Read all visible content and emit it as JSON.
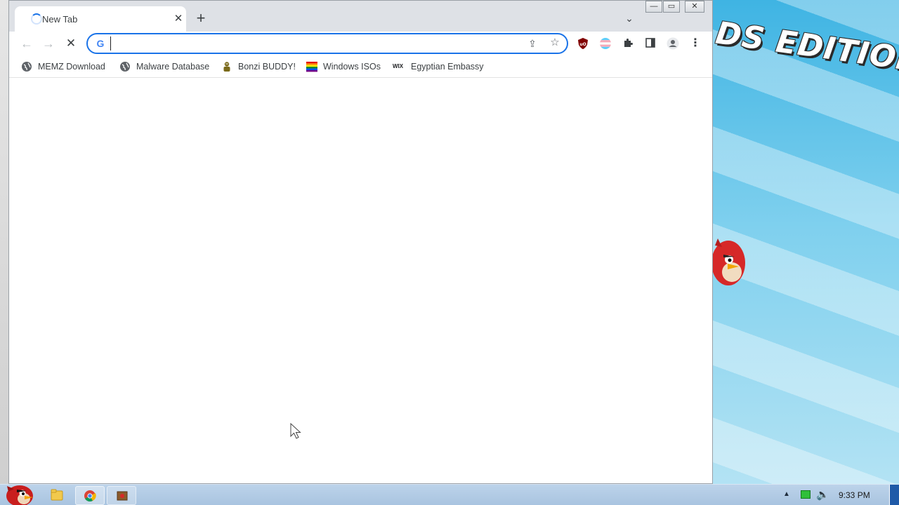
{
  "wallpaper": {
    "title_text": "DS EDITION"
  },
  "browser": {
    "tab": {
      "title": "New Tab",
      "close_glyph": "✕"
    },
    "new_tab_glyph": "+",
    "tab_search_glyph": "⌄",
    "window_controls": {
      "minimize": "—",
      "maximize": "▭",
      "close": "✕"
    },
    "toolbar": {
      "back_glyph": "←",
      "forward_glyph": "→",
      "stop_glyph": "✕",
      "omnibox_value": "",
      "omnibox_icon": "G",
      "share_glyph": "⇪",
      "star_glyph": "☆",
      "menu_glyph": "⋮",
      "puzzle_glyph": "✚"
    },
    "bookmarks": [
      {
        "label": "MEMZ Download",
        "icon": "globe-icon"
      },
      {
        "label": "Malware Database",
        "icon": "globe-icon"
      },
      {
        "label": "Bonzi BUDDY!",
        "icon": "bonzi-icon"
      },
      {
        "label": "Windows ISOs",
        "icon": "rainbow-flag-icon"
      },
      {
        "label": "Egyptian Embassy",
        "icon": "wix-icon"
      }
    ],
    "wix_text": "WIX"
  },
  "taskbar": {
    "clock": "9:33 PM",
    "tray_arrow": "▲",
    "volume_glyph": "🔈"
  },
  "colors": {
    "accent": "#1a73e8",
    "tabstrip": "#dee1e6",
    "taskbar": "#a9c4e0"
  }
}
